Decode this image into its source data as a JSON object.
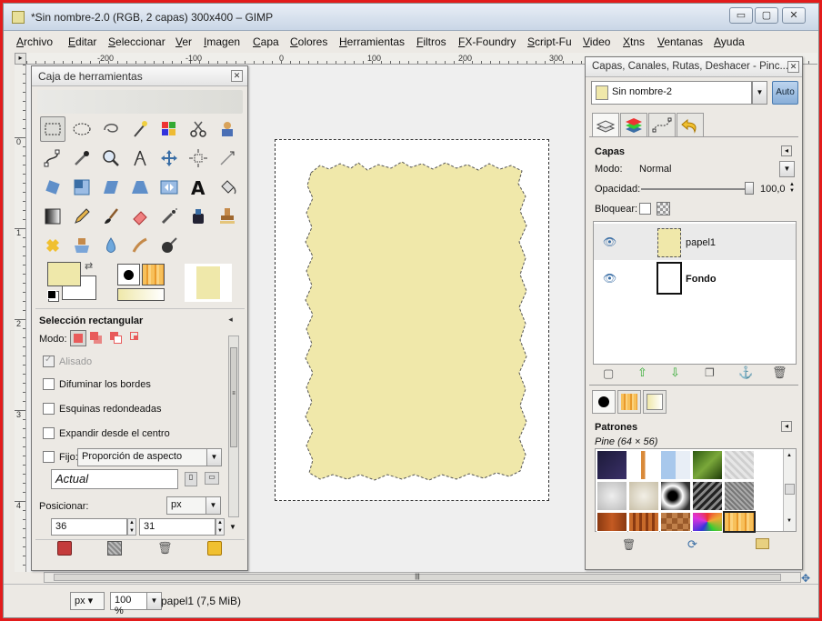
{
  "window": {
    "title": "*Sin nombre-2.0 (RGB, 2 capas) 300x400 – GIMP",
    "controls": {
      "minimize": "▭",
      "maximize": "▢",
      "close": "✕"
    }
  },
  "menu": [
    "Archivo",
    "Editar",
    "Seleccionar",
    "Ver",
    "Imagen",
    "Capa",
    "Colores",
    "Herramientas",
    "Filtros",
    "FX-Foundry",
    "Script-Fu",
    "Video",
    "Xtns",
    "Ventanas",
    "Ayuda"
  ],
  "ruler": {
    "h_labels": [
      "-200",
      "-100",
      "0",
      "100",
      "200",
      "300"
    ],
    "v_labels": [
      "0",
      "1",
      "2",
      "3",
      "4"
    ]
  },
  "toolbox": {
    "title": "Caja de herramientas",
    "tool_options_title": "Selección rectangular",
    "mode_label": "Modo:",
    "antialias_label": "Alisado",
    "feather_label": "Difuminar los bordes",
    "rounded_label": "Esquinas redondeadas",
    "expand_center_label": "Expandir desde el centro",
    "fixed_label": "Fijo:",
    "fixed_value": "Proporción de aspecto",
    "current_value": "Actual",
    "position_label": "Posicionar:",
    "unit_value": "px",
    "pos_x": "36",
    "pos_y": "31",
    "fg_color": "#efe8aa",
    "bg_color": "#ffffff"
  },
  "canvas": {
    "paper_color": "#f0e8aa"
  },
  "status": {
    "unit": "px",
    "zoom": "100 %",
    "info": "papel1 (7,5 MiB)"
  },
  "layers_dock": {
    "title": "Capas, Canales, Rutas, Deshacer - Pinc...",
    "image_name": "Sin nombre-2",
    "auto_label": "Auto",
    "section_title": "Capas",
    "mode_label": "Modo:",
    "mode_value": "Normal",
    "opacity_label": "Opacidad:",
    "opacity_value": "100,0",
    "lock_label": "Bloquear:",
    "layers": [
      {
        "name": "papel1",
        "bold": false
      },
      {
        "name": "Fondo",
        "bold": true
      }
    ],
    "patterns_title": "Patrones",
    "pattern_info": "Pine (64 × 56)"
  }
}
